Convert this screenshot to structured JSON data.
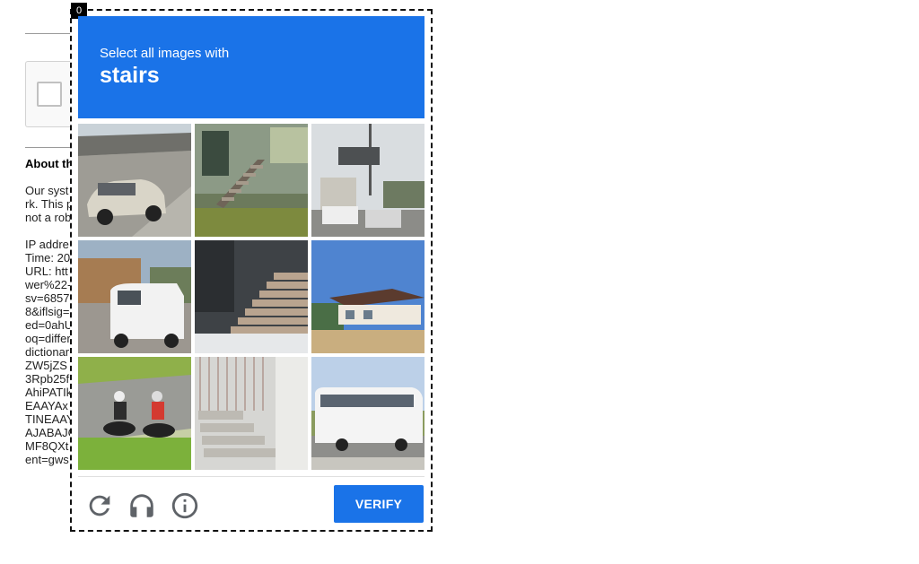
{
  "frame_index": "0",
  "challenge": {
    "instruction": "Select all images with",
    "target": "stairs",
    "verify_label": "VERIFY",
    "tiles": [
      {
        "content": "silver sedan on highway road"
      },
      {
        "content": "house exterior with wooden stairs"
      },
      {
        "content": "road overpass with billboard and vehicles"
      },
      {
        "content": "white van parked near house"
      },
      {
        "content": "concrete stairs with snow"
      },
      {
        "content": "house on hillside"
      },
      {
        "content": "motorcyclists on grassy road"
      },
      {
        "content": "concrete steps next to wall"
      },
      {
        "content": "white bus on highway"
      }
    ]
  },
  "background": {
    "about_title": "About th",
    "lines": [
      "Our syst",
      "rk. This p",
      "not a rob",
      "",
      "IP addre",
      "Time: 20",
      "URL: htt",
      "wer%22-",
      "sv=6857",
      "8&iflsig=",
      "ed=0ahU",
      "oq=differ",
      "dictionar",
      "ZW5jZS",
      "3Rpb25f",
      "AhiPATIk",
      "EAAYAx",
      "TINEAAY",
      "AJABAJC",
      "MF8QXt",
      "ent=gws"
    ]
  },
  "colors": {
    "accent": "#1a73e8",
    "border": "#111111"
  },
  "icons": [
    "reload-icon",
    "headphones-icon",
    "info-icon"
  ]
}
